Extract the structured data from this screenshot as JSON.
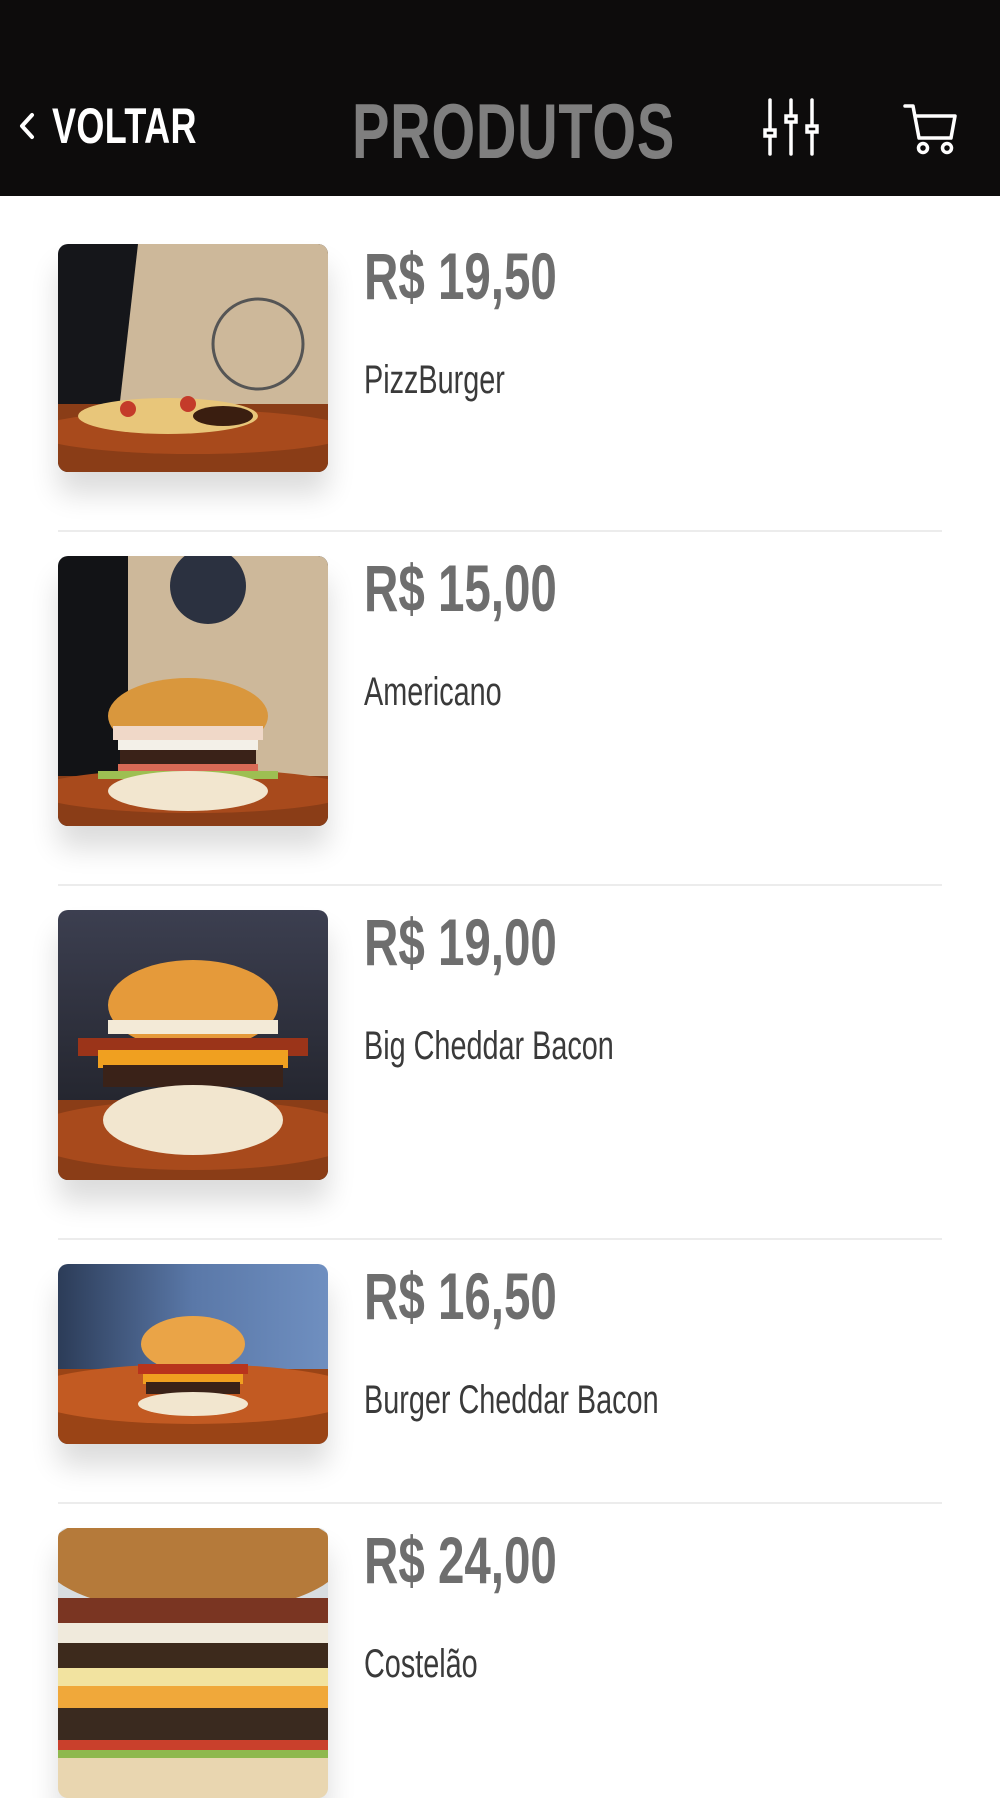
{
  "header": {
    "back_label": "VOLTAR",
    "title": "PRODUTOS",
    "icons": [
      "chevron-left-icon",
      "sliders-icon",
      "cart-icon"
    ],
    "background": "#0d0c0c",
    "title_color": "#7f7f7f"
  },
  "products": [
    {
      "price": "R$ 19,50",
      "name": "PizzBurger"
    },
    {
      "price": "R$ 15,00",
      "name": "Americano"
    },
    {
      "price": "R$ 19,00",
      "name": "Big Cheddar Bacon"
    },
    {
      "price": "R$ 16,50",
      "name": "Burger Cheddar Bacon"
    },
    {
      "price": "R$ 24,00",
      "name": "Costelão"
    }
  ],
  "colors": {
    "price": "#6e6e6e",
    "name": "#3a3a3a",
    "divider": "#ececec"
  }
}
